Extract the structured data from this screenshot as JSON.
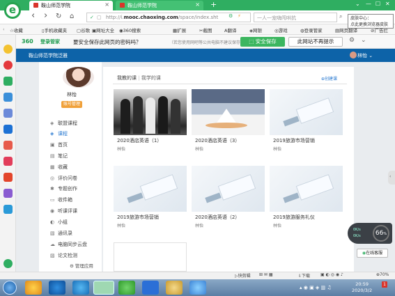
{
  "browser": {
    "tabs": [
      {
        "label": "鞍山师范学院",
        "close": "×"
      },
      {
        "label": "鞍山师范学院",
        "close": "×"
      }
    ],
    "new_tab": "+",
    "window_buttons": [
      "⌄",
      "—",
      "☐",
      "✕"
    ],
    "nav": {
      "back": "‹",
      "forward": "›",
      "reload": "↻",
      "home": "⌂"
    },
    "url_prefix": "http://i.",
    "url_domain": "mooc.chaoxing.com",
    "url_path": "/space/index.sht",
    "search_placeholder": "一人一宠嗨闯哄抗",
    "tooltip_line1": "皮肤中心：",
    "tooltip_line2": "点此更换浏览器皮肤"
  },
  "bookmarks": [
    "收藏",
    "手机收藏夹",
    "谷歌",
    "网址大全",
    "360搜索",
    "扩展",
    "截图",
    "翻译",
    "网银",
    "游戏",
    "登录管家",
    "网页翻译",
    "广告拦"
  ],
  "password_bar": {
    "brand": "360",
    "brand_sub": "登录管家",
    "question": "要安全保存此网页的密码吗？",
    "hint": "（若您使用网吧等公共电脑不建议保存）",
    "save_label": "安全保存",
    "no_prompt_label": "此网站不再提示",
    "settings_icon": "gear-icon",
    "close_icon": "close-icon"
  },
  "site": {
    "name": "鞍山师范学院泛雅",
    "user_name": "林怡",
    "user_caret": "⌄"
  },
  "profile": {
    "name": "林怡",
    "badge": "账号管理"
  },
  "nav_items": [
    {
      "label": "联盟课程",
      "icon": "◈",
      "active": false
    },
    {
      "label": "课程",
      "icon": "◈",
      "active": true
    },
    {
      "label": "首页",
      "icon": "▣",
      "active": false
    },
    {
      "label": "笔记",
      "icon": "▤",
      "active": false
    },
    {
      "label": "收藏",
      "icon": "▦",
      "active": false
    },
    {
      "label": "评价问卷",
      "icon": "◎",
      "active": false
    },
    {
      "label": "专题创作",
      "icon": "✱",
      "active": false
    },
    {
      "label": "收件箱",
      "icon": "▭",
      "active": false
    },
    {
      "label": "听课评课",
      "icon": "◉",
      "active": false
    },
    {
      "label": "小组",
      "icon": "◐",
      "active": false
    },
    {
      "label": "通讯录",
      "icon": "▧",
      "active": false
    },
    {
      "label": "电脑同步云盘",
      "icon": "☁",
      "active": false
    },
    {
      "label": "论文检测",
      "icon": "▨",
      "active": false
    }
  ],
  "manage_label": "管理应用",
  "content": {
    "tab_teach": "我教的课",
    "separator": "|",
    "tab_learn": "我学的课",
    "create_label": "创建课",
    "courses": [
      {
        "title": "2020酒店英语（1）",
        "teacher": "林怡",
        "img": "people"
      },
      {
        "title": "2020酒店英语（3）",
        "teacher": "林怡",
        "img": "dining"
      },
      {
        "title": "2019旅游市场营销",
        "teacher": "林怡",
        "img": "desk"
      },
      {
        "title": "2019旅游市场营销",
        "teacher": "林怡",
        "img": "desk"
      },
      {
        "title": "2020酒店英语（2）",
        "teacher": "林怡",
        "img": "desk"
      },
      {
        "title": "2019旅游服务礼仪",
        "teacher": "林怡",
        "img": "desk"
      }
    ]
  },
  "widgets": {
    "cpu_pct": "66",
    "cpu_unit": "%",
    "net_up": "0K/s",
    "net_down": "0K/s",
    "online_help": "在线客服"
  },
  "status_bar": {
    "quick_cut": "快剪辑",
    "download": "下载",
    "zoom": "70%"
  },
  "taskbar": {
    "time": "20:59",
    "date": "2020/3/2"
  },
  "colors": {
    "tab_green": "#2fae61",
    "header_blue": "#0d63a8",
    "save_green": "#3cb65f",
    "active_nav": "#2a7ad1"
  }
}
